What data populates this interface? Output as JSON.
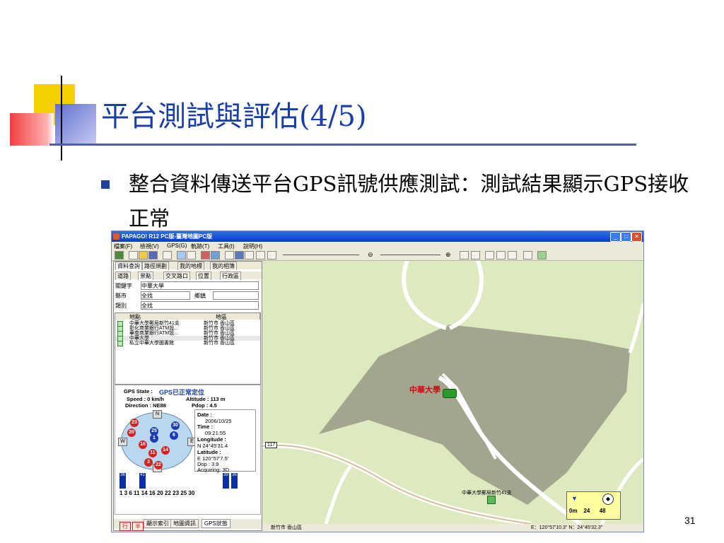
{
  "slide": {
    "title": "平台測試與評估(4/5)",
    "bullet_text": "整合資料傳送平台GPS訊號供應測試：測試結果顯示GPS接收正常",
    "page_number": "31"
  },
  "app": {
    "title": "PAPAGO! R12 PC版-臺灣地圖PC版",
    "menu": [
      "檔案(F)",
      "檢視(V)",
      "GPS(G)",
      "軌跡(T)",
      "工具(I)",
      "說明(H)"
    ],
    "tabs_row1": [
      "資料查詢",
      "路徑規劃",
      "我的地標",
      "我的相簿"
    ],
    "tabs_row2": [
      "道路",
      "景點",
      "交叉路口",
      "位置",
      "行政區"
    ],
    "keyword_label": "關鍵字",
    "keyword_value": "中華大學",
    "city_label": "縣市",
    "city_value": "全找",
    "town_label": "鄉鎮",
    "category_label": "類別",
    "category_value": "全找",
    "list_headers": [
      "地點",
      "地區"
    ],
    "list_rows": [
      {
        "name": "中華大學郵局新竹41支",
        "area": "新竹市 香山區"
      },
      {
        "name": "彰化商業銀行ATM設...",
        "area": "新竹市 香山區"
      },
      {
        "name": "華南商業銀行ATM設...",
        "area": "新竹市 香山區"
      },
      {
        "name": "中華大學",
        "area": "新竹市 香山區"
      },
      {
        "name": "私立中華大學圖書館",
        "area": "新竹市 香山區"
      }
    ],
    "gps": {
      "state_label": "GPS State :",
      "state_value": "GPS已正常定位",
      "speed": "Speed : 0 km/h",
      "altitude": "Altitude : 113 m",
      "direction": "Direction : NE88",
      "pdop": "Pdop : 4.5",
      "date_label": "Date :",
      "date_value": "2006/10/25",
      "time_label": "Time :",
      "time_value": "09:21:55",
      "lon_label": "Longitude :",
      "lon_value": "N  24°45'31.4",
      "lat_label": "Latitude :",
      "lat_value": "E  120°57'7.5'",
      "dop": "Dop : 3.9",
      "acquiring": "Acquiring: 3D",
      "compass": {
        "n": "N",
        "s": "S",
        "e": "E",
        "w": "W"
      },
      "satellites_red": [
        "23",
        "20",
        "16",
        "11",
        "14",
        "3",
        "22"
      ],
      "satellites_blue": [
        "30",
        "25",
        "6",
        "1"
      ],
      "bar_labels": [
        "36",
        "41",
        "39",
        "36"
      ],
      "axis_numbers": "1  3  6  11 14 16 20 22 23 25 30"
    },
    "bottom_tabs": [
      "行",
      "半",
      "顯示索引",
      "地圖資訊",
      "GPS狀態"
    ],
    "map": {
      "label_main": "中華大學",
      "label_poi": "中華大學郵局新竹41支",
      "road_number": "117",
      "scale": "0m    24      48"
    },
    "status": {
      "district": "新竹市 香山區",
      "coords": "E：120°57'10.3\"  N：24°45'32.3\""
    }
  },
  "colors": {
    "title": "#1a3ea8",
    "accent_yellow": "#f5d000",
    "accent_red": "#f05050",
    "accent_blue": "#1f3fa0"
  }
}
